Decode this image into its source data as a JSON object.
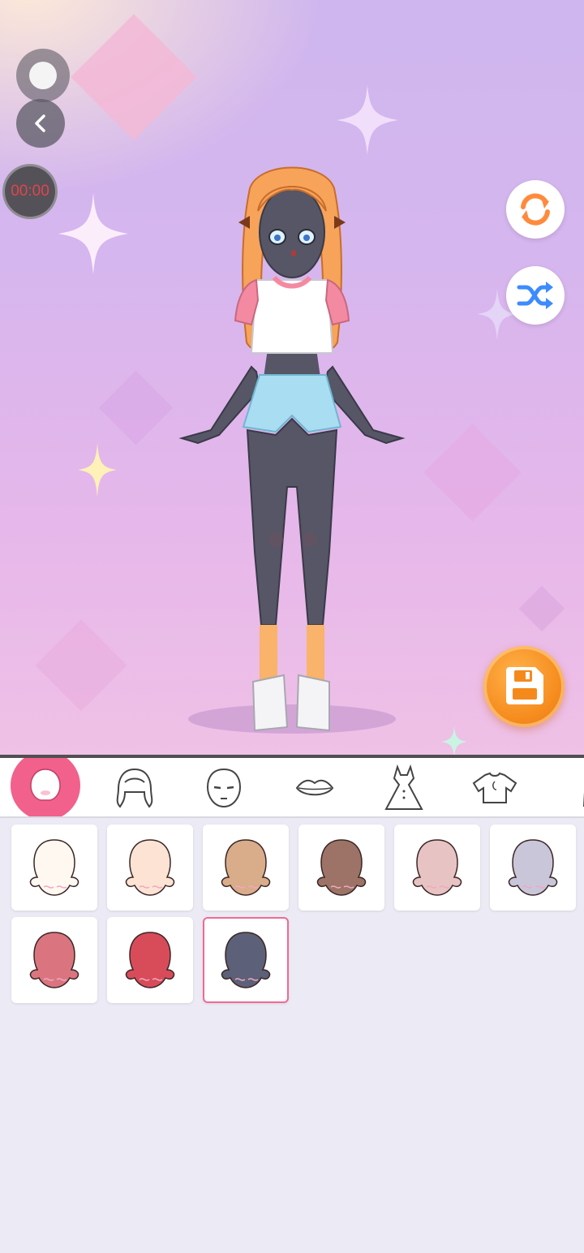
{
  "app": {
    "timer": "00:00"
  },
  "colors": {
    "accent_pink": "#f2608c",
    "save_orange": "#f58a1c",
    "reset_orange": "#ff8a3d",
    "shuffle_blue": "#3d8bff"
  },
  "top_controls": {
    "home_icon": "circle-dot-icon",
    "back_icon": "chevron-left-icon",
    "reset_icon": "refresh-icon",
    "shuffle_icon": "shuffle-icon",
    "save_icon": "floppy-disk-icon"
  },
  "category_tabs": [
    {
      "name": "skin",
      "icon": "head-silhouette-icon",
      "active": true
    },
    {
      "name": "hair",
      "icon": "hair-icon",
      "active": false
    },
    {
      "name": "face",
      "icon": "face-icon",
      "active": false
    },
    {
      "name": "mouth",
      "icon": "lips-icon",
      "active": false
    },
    {
      "name": "dress",
      "icon": "dress-icon",
      "active": false
    },
    {
      "name": "top",
      "icon": "shirt-icon",
      "active": false
    },
    {
      "name": "more",
      "icon": "partial-icon",
      "active": false
    }
  ],
  "skin_options": [
    {
      "color": "#fff8f1",
      "selected": false
    },
    {
      "color": "#fde3d4",
      "selected": false
    },
    {
      "color": "#d9ac8a",
      "selected": false
    },
    {
      "color": "#9c7366",
      "selected": false
    },
    {
      "color": "#e8c3c3",
      "selected": false
    },
    {
      "color": "#c9c6da",
      "selected": false
    },
    {
      "color": "#da7580",
      "selected": false
    },
    {
      "color": "#d84c5a",
      "selected": false
    },
    {
      "color": "#5c6078",
      "selected": true
    }
  ]
}
